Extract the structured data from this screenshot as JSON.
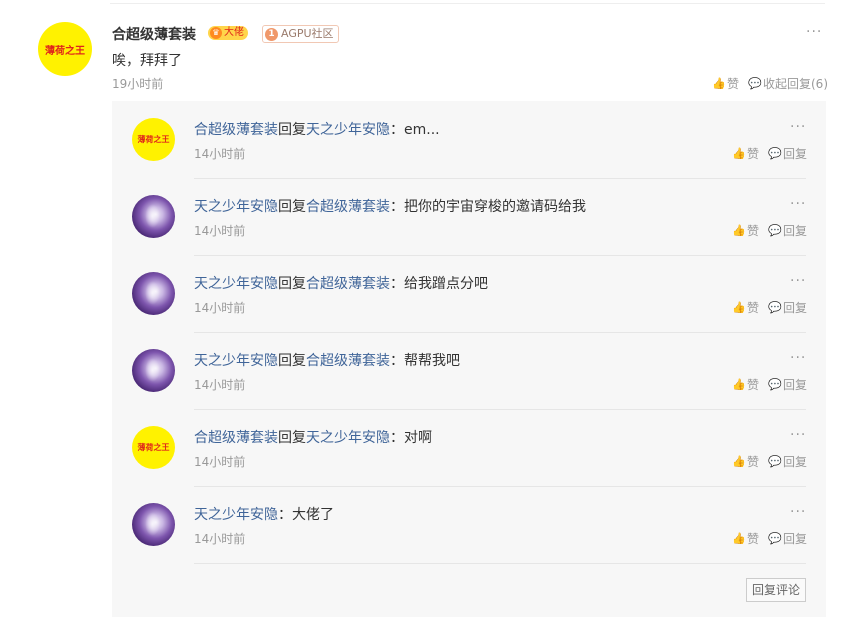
{
  "main_comment": {
    "avatar_text": "薄荷之王",
    "username": "合超级薄套装",
    "badge_title": "大佬",
    "level": "1",
    "community": "AGPU社区",
    "text": "唉，拜拜了",
    "time": "19小时前",
    "like_label": "赞",
    "collapse_label": "收起回复(6)",
    "more_label": "···"
  },
  "replies": [
    {
      "avatar": "yellow",
      "avatar_text": "薄荷之王",
      "from": "合超级薄套装",
      "reply_word": "回复",
      "to": "天之少年安隐",
      "sep": "：",
      "text": "em...",
      "time": "14小时前"
    },
    {
      "avatar": "purple",
      "avatar_text": "",
      "from": "天之少年安隐",
      "reply_word": "回复",
      "to": "合超级薄套装",
      "sep": "：",
      "text": "把你的宇宙穿梭的邀请码给我",
      "time": "14小时前"
    },
    {
      "avatar": "purple",
      "avatar_text": "",
      "from": "天之少年安隐",
      "reply_word": "回复",
      "to": "合超级薄套装",
      "sep": "：",
      "text": "给我蹭点分吧",
      "time": "14小时前"
    },
    {
      "avatar": "purple",
      "avatar_text": "",
      "from": "天之少年安隐",
      "reply_word": "回复",
      "to": "合超级薄套装",
      "sep": "：",
      "text": "帮帮我吧",
      "time": "14小时前"
    },
    {
      "avatar": "yellow",
      "avatar_text": "薄荷之王",
      "from": "合超级薄套装",
      "reply_word": "回复",
      "to": "天之少年安隐",
      "sep": "：",
      "text": "对啊",
      "time": "14小时前"
    },
    {
      "avatar": "purple",
      "avatar_text": "",
      "from": "天之少年安隐",
      "reply_word": "",
      "to": "",
      "sep": "：",
      "text": "大佬了",
      "time": "14小时前"
    }
  ],
  "reply_actions": {
    "like_label": "赞",
    "reply_label": "回复",
    "more_label": "···"
  },
  "reply_comment_button": "回复评论",
  "colors": {
    "username_link": "#406599",
    "avatar_yellow": "#fff200",
    "muted": "#999999"
  }
}
